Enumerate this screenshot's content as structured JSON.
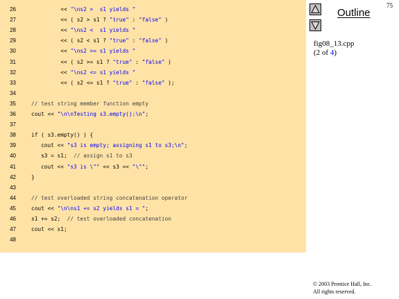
{
  "page_number": "75",
  "outline": {
    "title": "Outline",
    "file_name": "fig08_13.cpp",
    "slide_prefix": "(2 of ",
    "slide_total": "4",
    "slide_suffix": ")"
  },
  "nav": {
    "up_icon": "triangle-up-icon",
    "down_icon": "triangle-down-icon"
  },
  "colors": {
    "panel_background": "#ffe3a6",
    "string_literal": "#0000ff",
    "nav_button": "#c0c0c0"
  },
  "code": [
    {
      "num": "26",
      "segments": [
        {
          "t": "         << ",
          "k": "p"
        },
        {
          "t": "\"\\ns2 >  s1 yields \"",
          "k": "s"
        }
      ]
    },
    {
      "num": "27",
      "segments": [
        {
          "t": "         << ( s2 > s1 ? ",
          "k": "p"
        },
        {
          "t": "\"true\"",
          "k": "s"
        },
        {
          "t": " : ",
          "k": "p"
        },
        {
          "t": "\"false\"",
          "k": "s"
        },
        {
          "t": " )",
          "k": "p"
        }
      ]
    },
    {
      "num": "28",
      "segments": [
        {
          "t": "         << ",
          "k": "p"
        },
        {
          "t": "\"\\ns2 <  s1 yields \"",
          "k": "s"
        }
      ]
    },
    {
      "num": "29",
      "segments": [
        {
          "t": "         << ( s2 < s1 ? ",
          "k": "p"
        },
        {
          "t": "\"true\"",
          "k": "s"
        },
        {
          "t": " : ",
          "k": "p"
        },
        {
          "t": "\"false\"",
          "k": "s"
        },
        {
          "t": " )",
          "k": "p"
        }
      ]
    },
    {
      "num": "30",
      "segments": [
        {
          "t": "         << ",
          "k": "p"
        },
        {
          "t": "\"\\ns2 >= s1 yields \"",
          "k": "s"
        }
      ]
    },
    {
      "num": "31",
      "segments": [
        {
          "t": "         << ( s2 >= s1 ? ",
          "k": "p"
        },
        {
          "t": "\"true\"",
          "k": "s"
        },
        {
          "t": " : ",
          "k": "p"
        },
        {
          "t": "\"false\"",
          "k": "s"
        },
        {
          "t": " )",
          "k": "p"
        }
      ]
    },
    {
      "num": "32",
      "segments": [
        {
          "t": "         << ",
          "k": "p"
        },
        {
          "t": "\"\\ns2 <= s1 yields \"",
          "k": "s"
        }
      ]
    },
    {
      "num": "33",
      "segments": [
        {
          "t": "         << ( s2 <= s1 ? ",
          "k": "p"
        },
        {
          "t": "\"true\"",
          "k": "s"
        },
        {
          "t": " : ",
          "k": "p"
        },
        {
          "t": "\"false\"",
          "k": "s"
        },
        {
          "t": " );",
          "k": "p"
        }
      ]
    },
    {
      "num": "34",
      "segments": []
    },
    {
      "num": "35",
      "segments": [
        {
          "t": "// test string member function empty",
          "k": "c"
        }
      ]
    },
    {
      "num": "36",
      "segments": [
        {
          "t": "cout << ",
          "k": "p"
        },
        {
          "t": "\"\\n\\nTesting s3.empty():\\n\"",
          "k": "s"
        },
        {
          "t": ";",
          "k": "p"
        }
      ]
    },
    {
      "num": "37",
      "segments": []
    },
    {
      "num": "38",
      "segments": [
        {
          "t": "if ( s3.empty() ) {",
          "k": "p"
        }
      ]
    },
    {
      "num": "39",
      "segments": [
        {
          "t": "   cout << ",
          "k": "p"
        },
        {
          "t": "\"s3 is empty; assigning s1 to s3;\\n\"",
          "k": "s"
        },
        {
          "t": ";",
          "k": "p"
        }
      ]
    },
    {
      "num": "40",
      "segments": [
        {
          "t": "   s3 = s1;  ",
          "k": "p"
        },
        {
          "t": "// assign s1 to s3",
          "k": "c"
        }
      ]
    },
    {
      "num": "41",
      "segments": [
        {
          "t": "   cout << ",
          "k": "p"
        },
        {
          "t": "\"s3 is \\\"\"",
          "k": "s"
        },
        {
          "t": " << s3 << ",
          "k": "p"
        },
        {
          "t": "\"\\\"\"",
          "k": "s"
        },
        {
          "t": ";",
          "k": "p"
        }
      ]
    },
    {
      "num": "42",
      "segments": [
        {
          "t": "}",
          "k": "p"
        }
      ]
    },
    {
      "num": "43",
      "segments": []
    },
    {
      "num": "44",
      "segments": [
        {
          "t": "// test overloaded string concatenation operator",
          "k": "c"
        }
      ]
    },
    {
      "num": "45",
      "segments": [
        {
          "t": "cout << ",
          "k": "p"
        },
        {
          "t": "\"\\n\\ns1 += s2 yields s1 = \"",
          "k": "s"
        },
        {
          "t": ";",
          "k": "p"
        }
      ]
    },
    {
      "num": "46",
      "segments": [
        {
          "t": "s1 += s2;  ",
          "k": "p"
        },
        {
          "t": "// test overloaded concatenation",
          "k": "c"
        }
      ]
    },
    {
      "num": "47",
      "segments": [
        {
          "t": "cout << s1;",
          "k": "p"
        }
      ]
    },
    {
      "num": "48",
      "segments": []
    }
  ],
  "copyright": {
    "line1": "© 2003 Prentice Hall, Inc.",
    "line2": "All rights reserved."
  }
}
